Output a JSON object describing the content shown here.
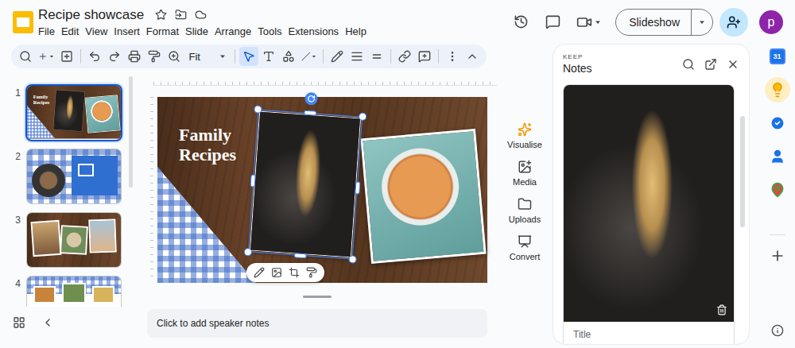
{
  "app": {
    "title": "Recipe showcase",
    "menu": [
      "File",
      "Edit",
      "View",
      "Insert",
      "Format",
      "Slide",
      "Arrange",
      "Tools",
      "Extensions",
      "Help"
    ]
  },
  "header": {
    "slideshow": "Slideshow",
    "avatar": "p"
  },
  "toolbar": {
    "groups": [
      [
        {
          "kind": "search",
          "selected": false
        },
        {
          "kind": "new",
          "selected": false
        },
        {
          "kind": "new-slide",
          "selected": false
        }
      ],
      [
        {
          "kind": "undo",
          "selected": false
        },
        {
          "kind": "redo",
          "selected": false
        },
        {
          "kind": "print",
          "selected": false
        },
        {
          "kind": "paint-format",
          "selected": false
        },
        {
          "kind": "zoom",
          "selected": false
        },
        {
          "kind": "zoom-select",
          "label": "Fit",
          "selected": false
        }
      ],
      [
        {
          "kind": "select",
          "selected": true
        },
        {
          "kind": "text-box",
          "selected": false
        },
        {
          "kind": "shape",
          "selected": false
        },
        {
          "kind": "line",
          "selected": false
        }
      ],
      [
        {
          "kind": "pen",
          "selected": false
        },
        {
          "kind": "line-weight",
          "selected": false
        },
        {
          "kind": "line-dash",
          "selected": false
        }
      ],
      [
        {
          "kind": "link",
          "selected": false
        },
        {
          "kind": "comment",
          "selected": false
        }
      ],
      [
        {
          "kind": "more",
          "selected": false
        }
      ]
    ]
  },
  "slides": [
    {
      "number": "1",
      "kind": "cover",
      "title": "Family Recipes",
      "selected": true
    },
    {
      "number": "2",
      "kind": "grid",
      "selected": false
    },
    {
      "number": "3",
      "kind": "collage",
      "selected": false
    },
    {
      "number": "4",
      "kind": "table",
      "selected": false
    }
  ],
  "canvas": {
    "photos": [
      {
        "kind": "pie",
        "selected": false
      },
      {
        "kind": "noodles",
        "selected": true
      }
    ]
  },
  "speaker_notes": {
    "placeholder": "Click to add speaker notes"
  },
  "side_actions": [
    {
      "kind": "visualise",
      "label": "Visualise"
    },
    {
      "kind": "media",
      "label": "Media"
    },
    {
      "kind": "uploads",
      "label": "Uploads"
    },
    {
      "kind": "convert",
      "label": "Convert"
    }
  ],
  "keep": {
    "app": "KEEP",
    "title": "Notes",
    "notes": [
      {
        "title_placeholder": "Title"
      }
    ]
  },
  "rail": [
    {
      "kind": "calendar",
      "label": "31",
      "selected": false
    },
    {
      "kind": "keep",
      "selected": true
    },
    {
      "kind": "tasks",
      "selected": false
    },
    {
      "kind": "contacts",
      "selected": false
    },
    {
      "kind": "maps",
      "selected": false
    }
  ]
}
